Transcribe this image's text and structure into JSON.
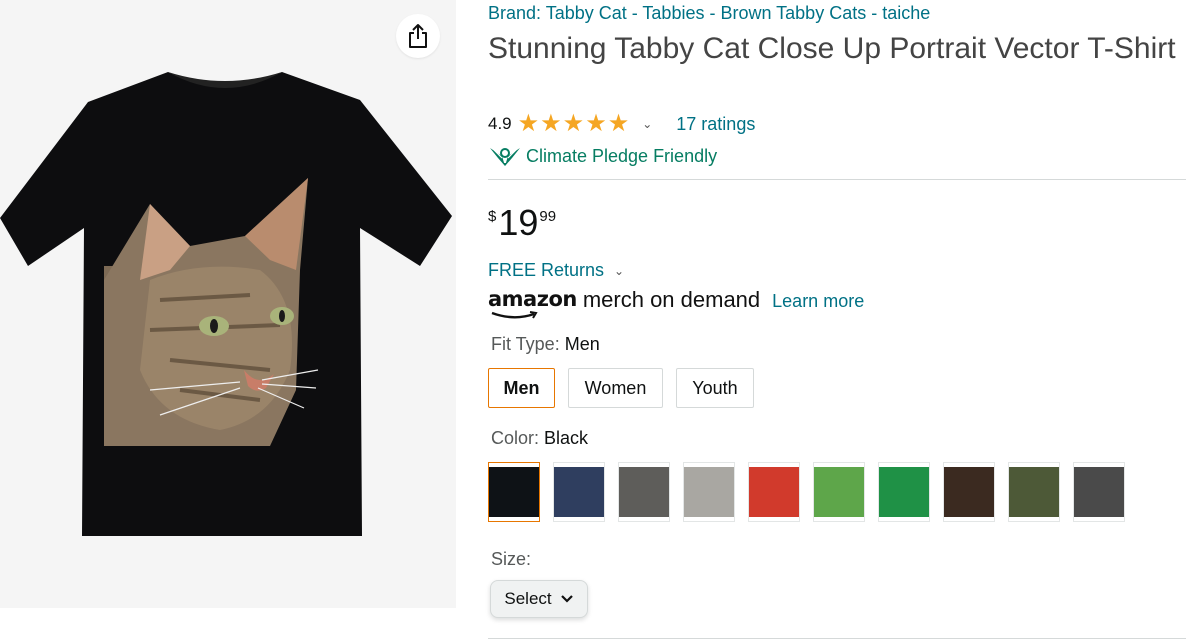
{
  "product": {
    "brand_link": "Brand: Tabby Cat - Tabbies - Brown Tabby Cats - taiche",
    "title": "Stunning Tabby Cat Close Up Portrait Vector T-Shirt",
    "rating_value": "4.9",
    "stars": 5,
    "ratings_link": "17 ratings",
    "climate_label": "Climate Pledge Friendly",
    "price": {
      "symbol": "$",
      "whole": "19",
      "fraction": "99"
    },
    "returns_link": "FREE Returns",
    "merch": {
      "logo": "amazon",
      "text": "merch on demand",
      "learn_more": "Learn more"
    }
  },
  "options": {
    "fit_type": {
      "label": "Fit Type: ",
      "value": "Men",
      "choices": [
        "Men",
        "Women",
        "Youth"
      ]
    },
    "color": {
      "label": "Color: ",
      "value": "Black",
      "swatches": [
        "#0e1216",
        "#2f3e5f",
        "#5e5d5a",
        "#a9a7a2",
        "#d13a2c",
        "#5ea64a",
        "#1f9146",
        "#3b2a20",
        "#4d5937",
        "#4a4a4a"
      ]
    },
    "size": {
      "label": "Size:",
      "select_label": "Select"
    }
  },
  "colors": {
    "link": "#007185",
    "star": "#f5a623",
    "climate": "#067d62",
    "selected_border": "#e77600"
  },
  "icons": [
    "share-icon",
    "star-icon",
    "chevron-down-icon",
    "climate-pledge-icon",
    "amazon-smile-logo"
  ]
}
